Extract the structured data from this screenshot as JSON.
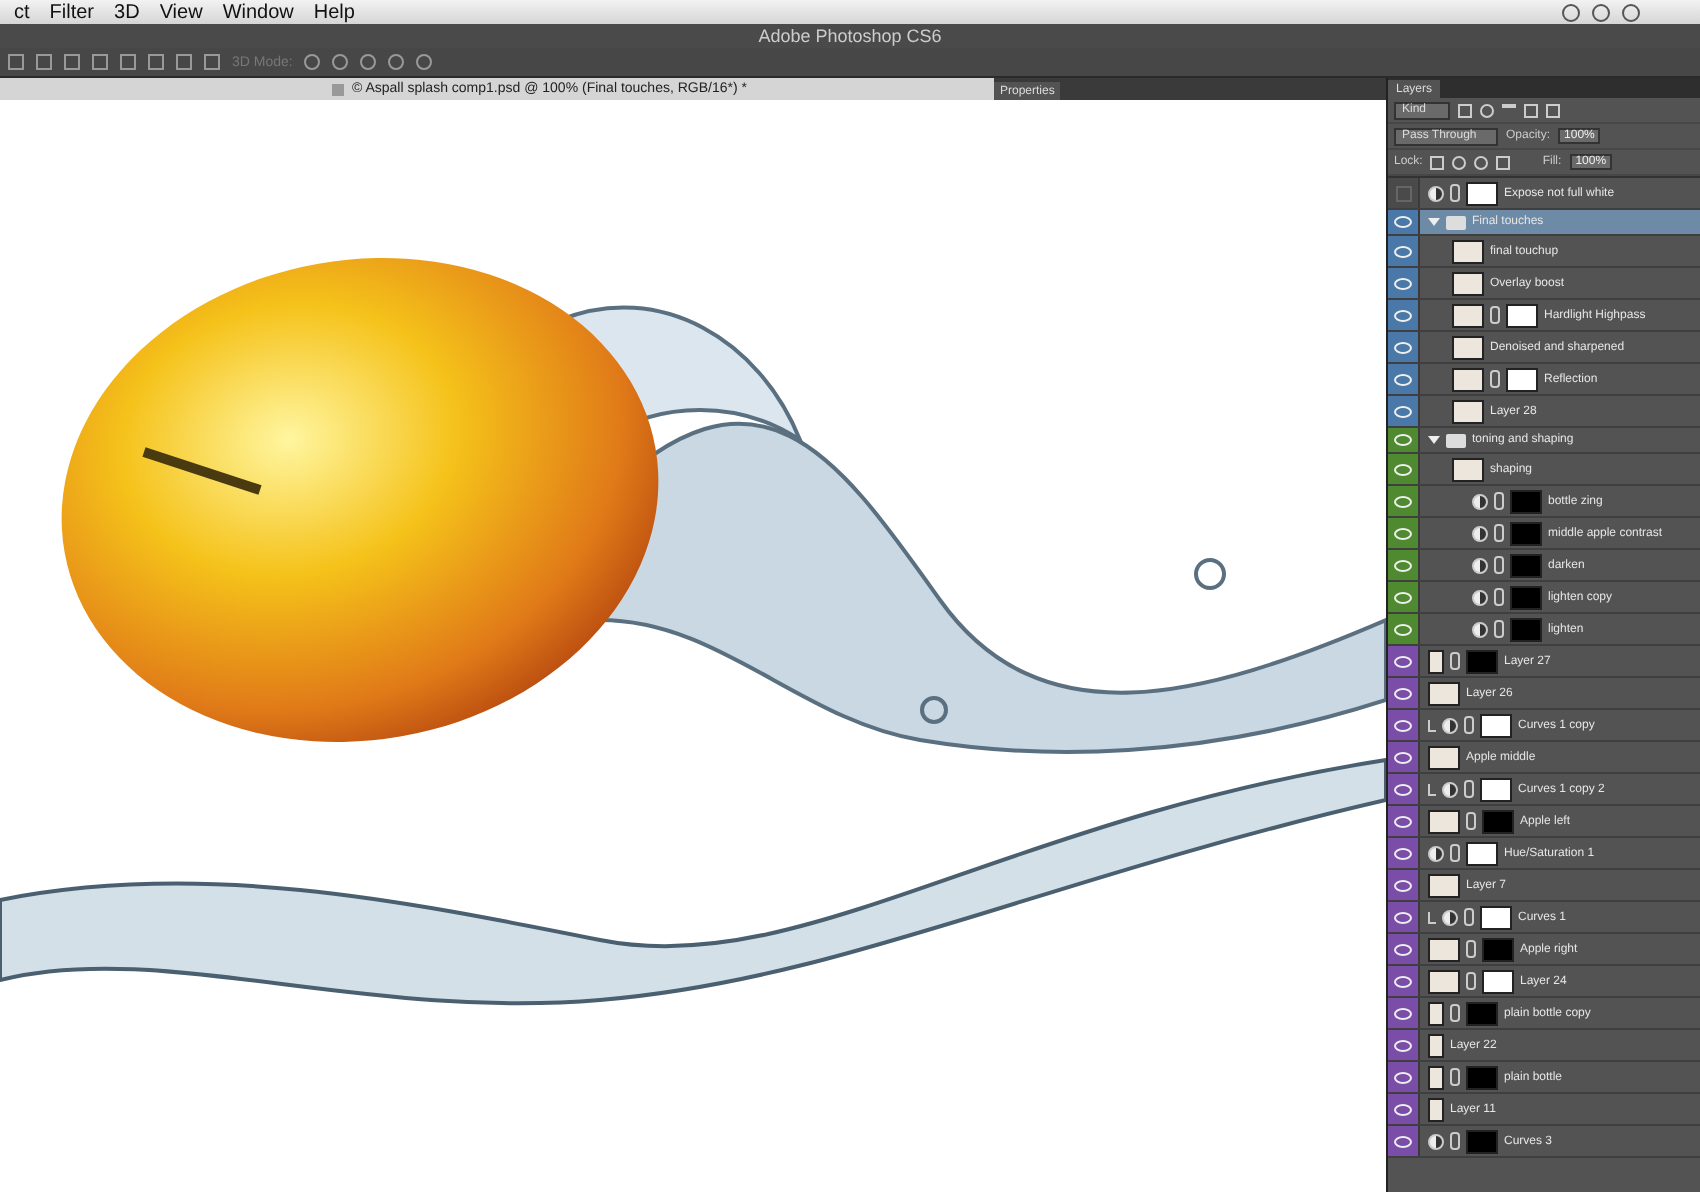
{
  "menu_bar": {
    "items": [
      "ct",
      "Filter",
      "3D",
      "View",
      "Window",
      "Help"
    ]
  },
  "window": {
    "title": "Adobe Photoshop CS6"
  },
  "options_bar": {
    "mode_label": "3D Mode:"
  },
  "document_tab": {
    "title": "© Aspall splash comp1.psd @ 100% (Final touches, RGB/16*) *"
  },
  "properties_panel": {
    "tab": "Properties"
  },
  "layers_panel": {
    "tab": "Layers",
    "filter": "Kind",
    "blend_mode": "Pass Through",
    "opacity_label": "Opacity:",
    "opacity": "100%",
    "lock_label": "Lock:",
    "fill_label": "Fill:",
    "fill": "100%",
    "layers": [
      {
        "name": "Expose not full white",
        "kind": "adjustment",
        "visible": false,
        "selected": false,
        "mask": true
      },
      {
        "name": "Final touches",
        "kind": "group",
        "visible": true,
        "selected": true,
        "expanded": true,
        "color": "#4a78a8",
        "children": [
          {
            "name": "final touchup",
            "kind": "pixel",
            "visible": true,
            "selected": false,
            "color": "#4a78a8"
          },
          {
            "name": "Overlay boost",
            "kind": "pixel",
            "visible": true,
            "selected": false,
            "color": "#4a78a8"
          },
          {
            "name": "Hardlight Highpass",
            "kind": "pixel",
            "visible": true,
            "selected": false,
            "mask": true,
            "color": "#4a78a8"
          },
          {
            "name": "Denoised and sharpened",
            "kind": "pixel",
            "visible": true,
            "selected": false,
            "color": "#4a78a8"
          },
          {
            "name": "Reflection",
            "kind": "pixel",
            "visible": true,
            "selected": false,
            "mask": true,
            "color": "#4a78a8"
          },
          {
            "name": "Layer 28",
            "kind": "pixel",
            "visible": true,
            "selected": false,
            "color": "#4a78a8"
          }
        ]
      },
      {
        "name": "toning and shaping",
        "kind": "group",
        "visible": true,
        "selected": false,
        "expanded": true,
        "color": "#4f8a30",
        "children": [
          {
            "name": "shaping",
            "kind": "pixel",
            "visible": true,
            "selected": false,
            "color": "#4f8a30"
          },
          {
            "name": "bottle zing",
            "kind": "adjustment",
            "visible": true,
            "selected": false,
            "mask": true,
            "dark_mask": true,
            "color": "#4f8a30"
          },
          {
            "name": "middle apple contrast",
            "kind": "adjustment",
            "visible": true,
            "selected": false,
            "mask": true,
            "dark_mask": true,
            "color": "#4f8a30"
          },
          {
            "name": "darken",
            "kind": "adjustment",
            "visible": true,
            "selected": false,
            "mask": true,
            "dark_mask": true,
            "color": "#4f8a30"
          },
          {
            "name": "lighten copy",
            "kind": "adjustment",
            "visible": true,
            "selected": false,
            "mask": true,
            "dark_mask": true,
            "color": "#4f8a30"
          },
          {
            "name": "lighten",
            "kind": "adjustment",
            "visible": true,
            "selected": false,
            "mask": true,
            "dark_mask": true,
            "color": "#4f8a30"
          }
        ]
      },
      {
        "name": "Layer 27",
        "kind": "pixel",
        "narrow": true,
        "visible": true,
        "selected": false,
        "mask": true,
        "dark_mask": true,
        "color": "#7a4ea8"
      },
      {
        "name": "Layer 26",
        "kind": "pixel",
        "visible": true,
        "selected": false,
        "color": "#7a4ea8"
      },
      {
        "name": "Curves 1 copy",
        "kind": "adjustment",
        "clipped": true,
        "visible": true,
        "selected": false,
        "mask": true,
        "color": "#7a4ea8"
      },
      {
        "name": "Apple middle",
        "kind": "pixel",
        "visible": true,
        "selected": false,
        "color": "#7a4ea8"
      },
      {
        "name": "Curves 1 copy 2",
        "kind": "adjustment",
        "clipped": true,
        "visible": true,
        "selected": false,
        "mask": true,
        "color": "#7a4ea8"
      },
      {
        "name": "Apple left",
        "kind": "pixel",
        "visible": true,
        "selected": false,
        "mask": true,
        "dark_mask": true,
        "color": "#7a4ea8"
      },
      {
        "name": "Hue/Saturation 1",
        "kind": "adjustment",
        "visible": true,
        "selected": false,
        "mask": true,
        "color": "#7a4ea8"
      },
      {
        "name": "Layer 7",
        "kind": "pixel",
        "visible": true,
        "selected": false,
        "color": "#7a4ea8"
      },
      {
        "name": "Curves 1",
        "kind": "adjustment",
        "clipped": true,
        "visible": true,
        "selected": false,
        "mask": true,
        "color": "#7a4ea8"
      },
      {
        "name": "Apple right",
        "kind": "pixel",
        "visible": true,
        "selected": false,
        "mask": true,
        "dark_mask": true,
        "color": "#7a4ea8"
      },
      {
        "name": "Layer 24",
        "kind": "pixel",
        "visible": true,
        "selected": false,
        "mask": true,
        "color": "#7a4ea8"
      },
      {
        "name": "plain bottle copy",
        "kind": "pixel",
        "narrow": true,
        "visible": true,
        "selected": false,
        "mask": true,
        "dark_mask": true,
        "color": "#7a4ea8"
      },
      {
        "name": "Layer 22",
        "kind": "pixel",
        "narrow": true,
        "visible": true,
        "selected": false,
        "color": "#7a4ea8"
      },
      {
        "name": "plain bottle",
        "kind": "pixel",
        "narrow": true,
        "visible": true,
        "selected": false,
        "mask": true,
        "dark_mask": true,
        "color": "#7a4ea8"
      },
      {
        "name": "Layer 11",
        "kind": "pixel",
        "narrow": true,
        "visible": true,
        "selected": false,
        "color": "#7a4ea8"
      },
      {
        "name": "Curves 3",
        "kind": "adjustment",
        "visible": true,
        "selected": false,
        "mask": true,
        "dark_mask": true,
        "color": "#7a4ea8"
      }
    ]
  }
}
